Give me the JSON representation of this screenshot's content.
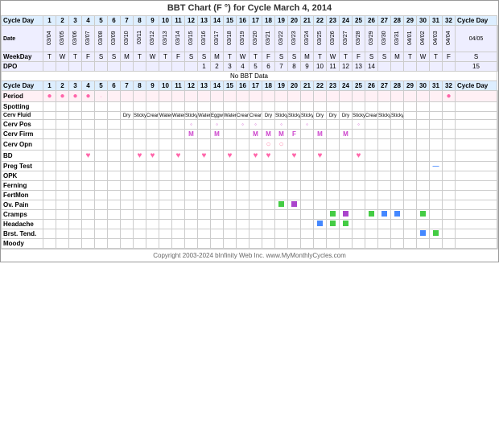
{
  "chart": {
    "title": "BBT Chart (F °) for Cycle March 4, 2014",
    "section1_label": "No BBT Data",
    "footer": "Copyright 2003-2024 bInfinity Web Inc.    www.MyMonthlyCycles.com"
  },
  "rows": {
    "cycle_day": "Cycle Day",
    "date": "Date",
    "weekday": "WeekDay",
    "dpo": "DPO",
    "period": "Period",
    "spotting": "Spotting",
    "cerv_fluid": "Cerv Fluid",
    "cerv_pos": "Cerv Pos",
    "cerv_firm": "Cerv Firm",
    "cerv_opn": "Cerv Opn",
    "bd": "BD",
    "preg_test": "Preg Test",
    "opk": "OPK",
    "ferning": "Ferning",
    "fertmon": "FertMon",
    "ov_pain": "Ov. Pain",
    "cramps": "Cramps",
    "headache": "Headache",
    "brst_tend": "Brst. Tend.",
    "moody": "Moody"
  }
}
